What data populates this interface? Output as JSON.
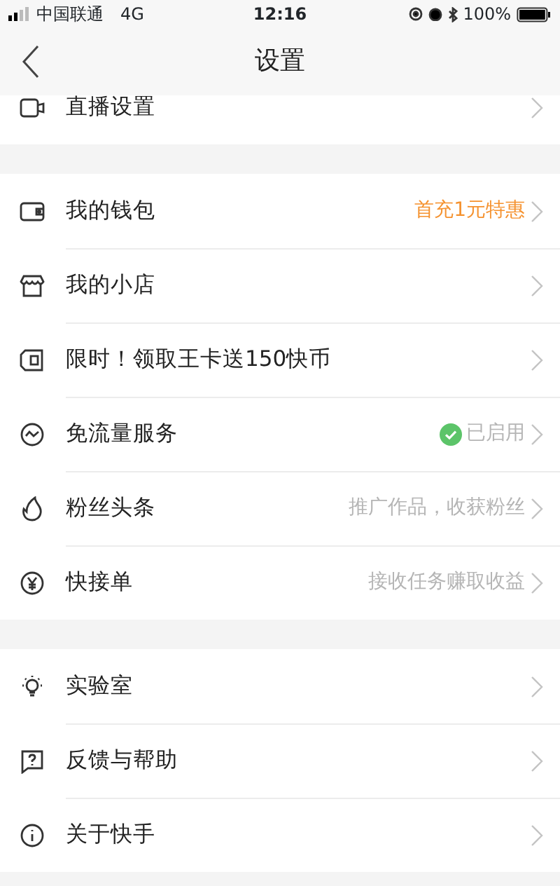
{
  "status_bar": {
    "carrier": "中国联通",
    "network": "4G",
    "time": "12:16",
    "battery": "100%"
  },
  "nav": {
    "title": "设置"
  },
  "groups": [
    [
      {
        "label": "直播设置"
      }
    ],
    [
      {
        "label": "我的钱包",
        "detail": {
          "kind": "promo",
          "text": "首充1元特惠"
        }
      },
      {
        "label": "我的小店"
      },
      {
        "label": "限时！领取王卡送150快币"
      },
      {
        "label": "免流量服务",
        "detail": {
          "kind": "enabled",
          "text": "已启用"
        }
      },
      {
        "label": "粉丝头条",
        "detail": {
          "kind": "hint",
          "text": "推广作品，收获粉丝"
        }
      },
      {
        "label": "快接单",
        "detail": {
          "kind": "hint",
          "text": "接收任务赚取收益"
        }
      }
    ],
    [
      {
        "label": "实验室"
      },
      {
        "label": "反馈与帮助"
      },
      {
        "label": "关于快手"
      }
    ]
  ]
}
